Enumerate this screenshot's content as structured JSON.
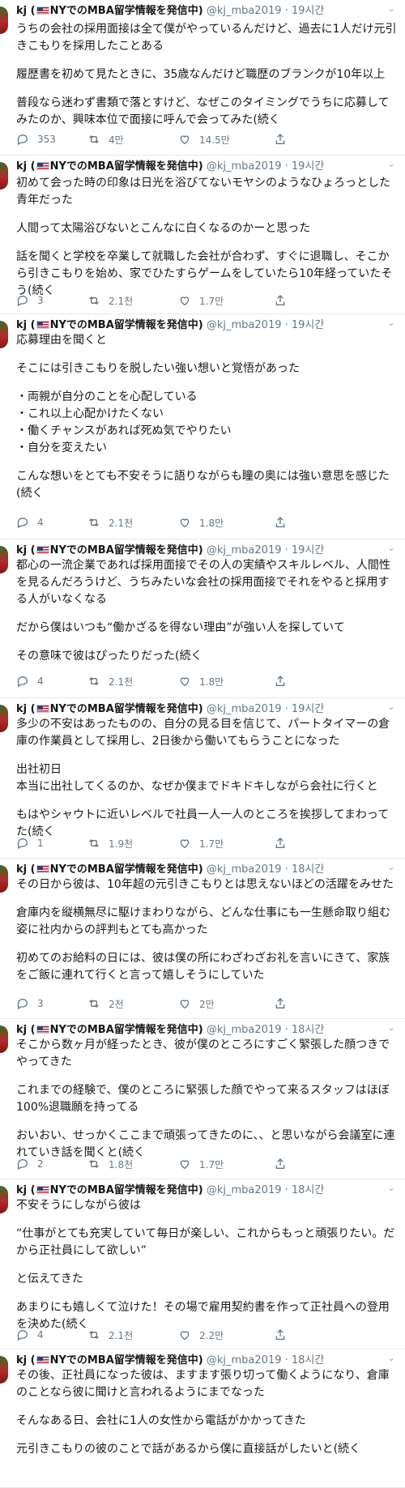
{
  "author": {
    "name_prefix": "kj (",
    "name_suffix": "NYでのMBA留学情報を発信中)",
    "flag_icon": "us-flag-icon"
  },
  "tweets": [
    {
      "handle": "@kj_mba2019",
      "time": "19시간",
      "paragraphs": [
        "うちの会社の採用面接は全て僕がやっているんだけど、過去に1人だけ元引きこもりを採用したことある",
        "履歴書を初めて見たときに、35歳なんだけど職歴のブランクが10年以上",
        "普段なら迷わず書類で落とすけど、なぜこのタイミングでうちに応募してみたのか、興味本位で面接に呼んで会ってみた(続く"
      ],
      "replies": "353",
      "retweets": "4만",
      "likes": "14.5만"
    },
    {
      "handle": "@kj_mba2019",
      "time": "19시간",
      "paragraphs": [
        "初めて会った時の印象は日光を浴びてないモヤシのようなひょろっとした青年だった",
        "人間って太陽浴びないとこんなに白くなるのかーと思った",
        "話を聞くと学校を卒業して就職した会社が合わず、すぐに退職し、そこから引きこもりを始め、家でひたすらゲームをしていたら10年経っていたそう(続く"
      ],
      "replies": "3",
      "retweets": "2.1천",
      "likes": "1.7만"
    },
    {
      "handle": "@kj_mba2019",
      "time": "19시간",
      "paragraphs": [
        "応募理由を聞くと",
        "そこには引きこもりを脱したい強い想いと覚悟があった",
        "・両親が自分のことを心配している\n・これ以上心配かけたくない\n・働くチャンスがあれば死ぬ気でやりたい\n・自分を変えたい",
        "こんな想いをとても不安そうに語りながらも瞳の奥には強い意思を感じた(続く"
      ],
      "replies": "4",
      "retweets": "2.1천",
      "likes": "1.8만"
    },
    {
      "handle": "@kj_mba2019",
      "time": "19시간",
      "paragraphs": [
        "都心の一流企業であれば採用面接でその人の実績やスキルレベル、人間性を見るんだろうけど、うちみたいな会社の採用面接でそれをやると採用する人がいなくなる",
        "だから僕はいつも“働かざるを得ない理由”が強い人を探していて",
        "その意味で彼はぴったりだった(続く"
      ],
      "replies": "4",
      "retweets": "2.1천",
      "likes": "1.8만"
    },
    {
      "handle": "@kj_mba2019",
      "time": "19시간",
      "paragraphs": [
        "多少の不安はあったものの、自分の見る目を信じて、パートタイマーの倉庫の作業員として採用し、2日後から働いてもらうことになった",
        "出社初日\n本当に出社してくるのか、なぜか僕までドキドキしながら会社に行くと",
        "もはやシャウトに近いレベルで社員一人一人のところを挨拶してまわってた(続く"
      ],
      "replies": "1",
      "retweets": "1.9천",
      "likes": "1.7만"
    },
    {
      "handle": "@kj_mba2019",
      "time": "18시간",
      "paragraphs": [
        "その日から彼は、10年超の元引きこもりとは思えないほどの活躍をみせた",
        "倉庫内を縦横無尽に駆けまわりながら、どんな仕事にも一生懸命取り組む姿に社内からの評判もとても高かった",
        "初めてのお給料の日には、彼は僕の所にわざわざお礼を言いにきて、家族をご飯に連れて行くと言って嬉しそうにしていた"
      ],
      "replies": "3",
      "retweets": "2천",
      "likes": "2만"
    },
    {
      "handle": "@kj_mba2019",
      "time": "18시간",
      "paragraphs": [
        "そこから数ヶ月が経ったとき、彼が僕のところにすごく緊張した顔つきでやってきた",
        "これまでの経験で、僕のところに緊張した顔でやって来るスタッフはほぼ100%退職願を持ってる",
        "おいおい、せっかくここまで頑張ってきたのに、、と思いながら会議室に連れていき話を聞くと(続く"
      ],
      "replies": "2",
      "retweets": "1.8천",
      "likes": "1.7만"
    },
    {
      "handle": "@kj_mba2019",
      "time": "18시간",
      "paragraphs": [
        "不安そうにしながら彼は",
        "“仕事がとても充実していて毎日が楽しい、これからもっと頑張りたい。だから正社員にして欲しい”",
        "と伝えてきた",
        "あまりにも嬉しくて泣けた！その場で雇用契約書を作って正社員への登用を決めた(続く"
      ],
      "replies": "4",
      "retweets": "2.1천",
      "likes": "2.2만"
    },
    {
      "handle": "@kj_mba2019",
      "time": "18시간",
      "paragraphs": [
        "その後、正社員になった彼は、ますます張り切って働くようになり、倉庫のことなら彼に聞けと言われるようにまでなった",
        "そんなある日、会社に1人の女性から電話がかかってきた",
        "元引きこもりの彼のことで話があるから僕に直接話がしたいと(続く"
      ],
      "replies": "",
      "retweets": "",
      "likes": ""
    }
  ]
}
